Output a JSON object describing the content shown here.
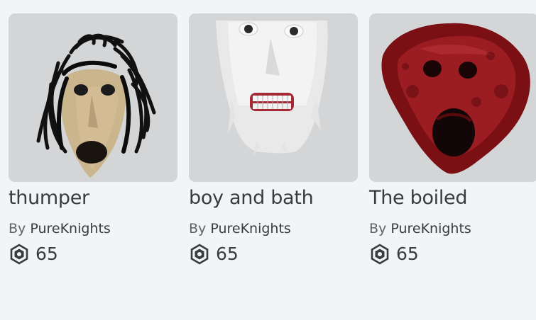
{
  "catalog": {
    "items": [
      {
        "name": "thumper",
        "by": "By",
        "creator": "PureKnights",
        "price": "65",
        "currency_icon": "robux-icon"
      },
      {
        "name": "boy and bath",
        "by": "By",
        "creator": "PureKnights",
        "price": "65",
        "currency_icon": "robux-icon"
      },
      {
        "name": "The boiled",
        "by": "By",
        "creator": "PureKnights",
        "price": "65",
        "currency_icon": "robux-icon"
      }
    ]
  },
  "colors": {
    "background": "#f2f4f5",
    "thumbnail_bg": "#d4d5d7",
    "text_primary": "#393b3d",
    "text_secondary": "#606264"
  }
}
